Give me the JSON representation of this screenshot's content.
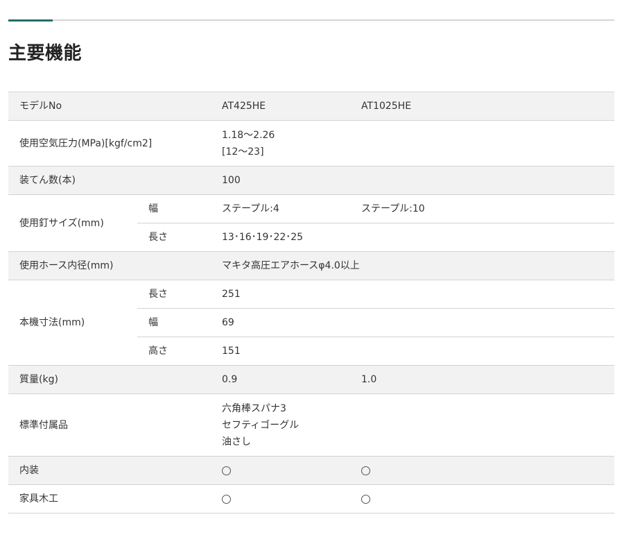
{
  "page": {
    "title": "主要機能"
  },
  "spec": {
    "header": {
      "label": "モデルNo",
      "model1": "AT425HE",
      "model2": "AT1025HE"
    },
    "pressure": {
      "label": "使用空気圧力(MPa)[kgf/cm2]",
      "value_line1": "1.18〜2.26",
      "value_line2": "[12〜23]"
    },
    "capacity": {
      "label": "装てん数(本)",
      "value": "100"
    },
    "nail_size": {
      "label": "使用釘サイズ(mm)",
      "width": {
        "label": "幅",
        "model1": "ステープル:4",
        "model2": "ステープル:10"
      },
      "length": {
        "label": "長さ",
        "value": "13･16･19･22･25"
      }
    },
    "hose": {
      "label": "使用ホース内径(mm)",
      "value": "マキタ高圧エアホースφ4.0以上"
    },
    "dimensions": {
      "label": "本機寸法(mm)",
      "length": {
        "label": "長さ",
        "value": "251"
      },
      "width": {
        "label": "幅",
        "value": "69"
      },
      "height": {
        "label": "高さ",
        "value": "151"
      }
    },
    "weight": {
      "label": "質量(kg)",
      "model1": "0.9",
      "model2": "1.0"
    },
    "accessories": {
      "label": "標準付属品",
      "items": [
        "六角棒スパナ3",
        "セフティゴーグル",
        "油さし"
      ]
    },
    "interior": {
      "label": "内装",
      "model1": "〇",
      "model2": "〇"
    },
    "furniture": {
      "label": "家具木工",
      "model1": "〇",
      "model2": "〇"
    }
  }
}
